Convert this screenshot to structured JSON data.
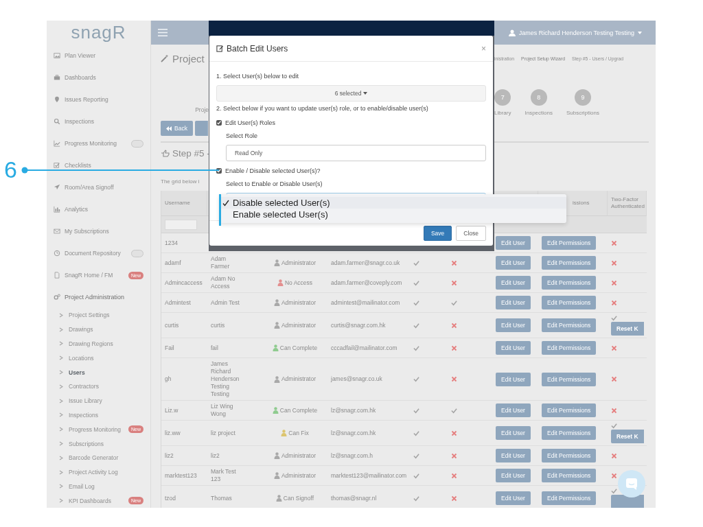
{
  "sidebar": {
    "logo": "snagR",
    "items": [
      {
        "kind": "link",
        "label": "Plan Viewer"
      },
      {
        "kind": "link",
        "label": "Dashboards"
      },
      {
        "kind": "link",
        "label": "Issues Reporting"
      },
      {
        "kind": "link",
        "label": "Inspections"
      },
      {
        "kind": "link",
        "label": "Progress Monitoring",
        "badge_blank": true
      },
      {
        "kind": "link",
        "label": "Checklists"
      },
      {
        "kind": "link",
        "label": "Room/Area Signoff"
      },
      {
        "kind": "link",
        "label": "Analytics"
      },
      {
        "kind": "link",
        "label": "My Subscriptions"
      },
      {
        "kind": "link",
        "label": "Document Repository",
        "badge_blank": true
      },
      {
        "kind": "link",
        "label": "SnagR Home / FM",
        "badge": "New"
      },
      {
        "kind": "section",
        "label": "Project Administration",
        "expanded": true,
        "children": [
          {
            "label": "Project Settings",
            "selected": false
          },
          {
            "label": "Drawings",
            "selected": false
          },
          {
            "label": "Drawing Regions",
            "selected": false
          },
          {
            "label": "Locations",
            "selected": false
          },
          {
            "label": "Users",
            "selected": true
          },
          {
            "label": "Contractors",
            "selected": false
          },
          {
            "label": "Issue Library",
            "selected": false
          },
          {
            "label": "Inspections",
            "selected": false
          },
          {
            "label": "Progress Monitoring",
            "selected": false,
            "badge": "New"
          },
          {
            "label": "Subscriptions",
            "selected": false
          },
          {
            "label": "Barcode Generator",
            "selected": false
          },
          {
            "label": "Project Activity Log",
            "selected": false
          },
          {
            "label": "Email Log",
            "selected": false
          },
          {
            "label": "KPI Dashboards",
            "selected": false,
            "badge": "New"
          }
        ]
      }
    ]
  },
  "top_bar": {
    "user": "James Richard Henderson Testing Testing"
  },
  "page": {
    "title": "Project",
    "breadcrumbs": [
      "inistration",
      "Project Setup Wizard",
      "Step #5 - Users / Upgrad"
    ],
    "step_left": "Proje",
    "steps": [
      {
        "number": "7",
        "label": "Library"
      },
      {
        "number": "8",
        "label": "Inspections"
      },
      {
        "number": "9",
        "label": "Subscriptions"
      }
    ],
    "back_button": "Back",
    "section_title": "Step #5 -",
    "intro": "The grid below i"
  },
  "table": {
    "columns": [
      "Username",
      "issions",
      "Two-Factor Authenticated"
    ],
    "rows": [
      {
        "username": "1234",
        "buttons": [
          "Edit User",
          "Edit Permissions"
        ],
        "two_factor": false
      },
      {
        "username": "adamf",
        "name": "Adam Farmer",
        "role": "Administrator",
        "color": "#a9a9a9",
        "email": "adam.farmer@snagr.co.uk",
        "column_5": true,
        "column_6": false,
        "buttons": [
          "Edit User",
          "Edit Permissions"
        ],
        "two_factor": false
      },
      {
        "username": "Admincaccess",
        "name": "Adam No Access",
        "role": "No Access",
        "color": "#e38f8f",
        "email": "adam.farmer@coveply.com",
        "column_5": true,
        "column_6": false,
        "buttons": [
          "Edit User",
          "Edit Permissions"
        ],
        "two_factor": false
      },
      {
        "username": "Admintest",
        "name": "Admin Test",
        "role": "Administrator",
        "color": "#a9a9a9",
        "email": "admintest@mailinator.com",
        "column_5": true,
        "column_6": true,
        "buttons": [
          "Edit User",
          "Edit Permissions"
        ],
        "two_factor": false
      },
      {
        "username": "curtis",
        "name": "curtis",
        "role": "Administrator",
        "color": "#a9a9a9",
        "email": "curtis@snagr.com.hk",
        "column_5": true,
        "column_6": false,
        "buttons": [
          "Edit User",
          "Edit Permissions"
        ],
        "two_factor": true,
        "reset_button": "Reset K"
      },
      {
        "username": "Fail",
        "name": "fail",
        "role": "Can Complete",
        "color": "#8fcb8f",
        "email": "cccadfail@mailinator.com",
        "column_5": true,
        "column_6": false,
        "buttons": [
          "Edit User",
          "Edit Permissions"
        ],
        "two_factor": false
      },
      {
        "username": "gh",
        "name": "James Richard Henderson Testing Testing",
        "role": "Administrator",
        "color": "#a9a9a9",
        "email": "james@snagr.co.uk",
        "column_5": true,
        "column_6": false,
        "buttons": [
          "Edit User",
          "Edit Permissions"
        ],
        "two_factor": false
      },
      {
        "username": "Liz.w",
        "name": "Liz Wing Wong",
        "role": "Can Complete",
        "color": "#8fcb8f",
        "email": "lz@snagr.com.hk",
        "column_5": true,
        "column_6": true,
        "buttons": [
          "Edit User",
          "Edit Permissions"
        ],
        "two_factor": false
      },
      {
        "username": "liz.ww",
        "name": "liz project",
        "role": "Can Fix",
        "color": "#dcc56f",
        "email": "lz@snagr.com.hk",
        "column_5": true,
        "column_6": false,
        "buttons": [
          "Edit User",
          "Edit Permissions"
        ],
        "two_factor": true,
        "reset_button": "Reset K"
      },
      {
        "username": "liz2",
        "name": "liz2",
        "role": "Administrator",
        "color": "#a9a9a9",
        "email": "lz@snagr.com.h",
        "column_5": true,
        "column_6": false,
        "buttons": [
          "Edit User",
          "Edit Permissions"
        ],
        "two_factor": false
      },
      {
        "username": "marktest123",
        "name": "Mark Test 123",
        "role": "Administrator",
        "color": "#a9a9a9",
        "email": "marktest123@mailinator.com",
        "column_5": true,
        "column_6": false,
        "buttons": [
          "Edit User",
          "Edit Permissions"
        ],
        "two_factor": false
      },
      {
        "username": "tzod",
        "name": "Thomas",
        "role": "Can Signoff",
        "color": "#a9a9a9",
        "email": "thomas@snagr.nl",
        "column_5": true,
        "column_6": false,
        "buttons": [
          "Edit User",
          "Edit Permissions"
        ],
        "two_factor": true
      }
    ]
  },
  "modal": {
    "title": "Batch Edit Users",
    "close": "×",
    "step_1": "1. Select User(s) below to edit",
    "user_picker": "6 selected",
    "step_2": "2. Select below if you want to update user(s) role, or to enable/disable user(s)",
    "options": [
      {
        "label": "Edit User(s) Roles",
        "checked": true,
        "field_label": "Select Role",
        "value": "Read Only"
      },
      {
        "label": "Enable / Disable selected User(s)?",
        "checked": true,
        "field_label": "Select to Enable or Disable User(s)"
      }
    ],
    "buttons": [
      "Save",
      "Close"
    ]
  },
  "dropdown_menu": {
    "options": [
      {
        "label": "Disable selected User(s)",
        "selected": true
      },
      {
        "label": "Enable selected User(s)",
        "selected": false
      }
    ]
  },
  "annotation": {
    "number": "6"
  }
}
